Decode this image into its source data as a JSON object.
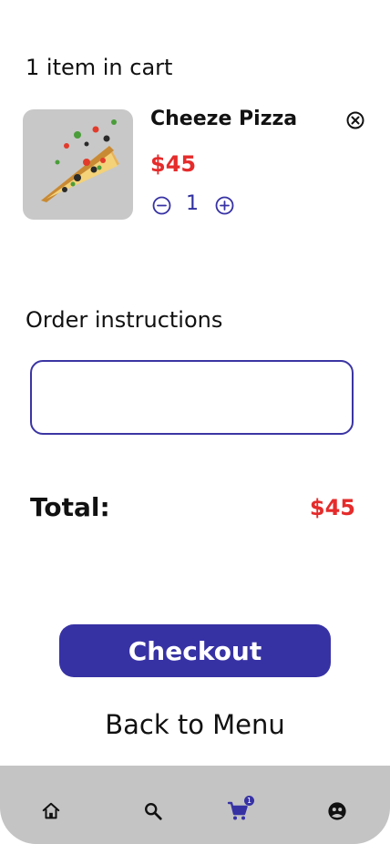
{
  "cart": {
    "count_label": "1 item in cart"
  },
  "item": {
    "name": "Cheeze Pizza",
    "price": "$45",
    "quantity": "1",
    "image_icon": "pizza-slice-image"
  },
  "instructions": {
    "label": "Order instructions",
    "value": "",
    "placeholder": ""
  },
  "total": {
    "label": "Total:",
    "value": "$45"
  },
  "actions": {
    "checkout_label": "Checkout",
    "back_label": "Back to Menu"
  },
  "nav": {
    "cart_badge": "1",
    "items": [
      {
        "icon": "home-icon"
      },
      {
        "icon": "search-icon"
      },
      {
        "icon": "cart-icon"
      },
      {
        "icon": "profile-icon"
      }
    ]
  },
  "colors": {
    "accent": "#3732a4",
    "price": "#e52b2b",
    "nav_background": "#c4c4c4"
  }
}
